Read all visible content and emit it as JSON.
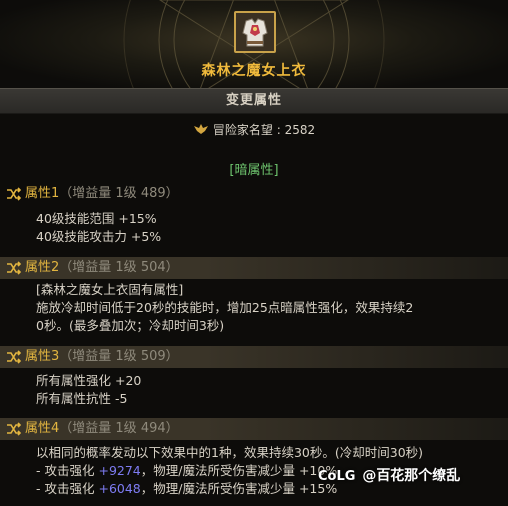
{
  "item": {
    "name": "森林之魔女上衣",
    "icon": "witch-coat-icon"
  },
  "section_title": "变更属性",
  "fame": {
    "label": "冒险家名望",
    "value": "2582"
  },
  "element_tag": "[暗属性]",
  "attributes": [
    {
      "label": "属性1",
      "gain": "（增益量 1级 489）",
      "lines": [
        "40级技能范围 +15%",
        "40级技能攻击力 +5%"
      ]
    },
    {
      "label": "属性2",
      "gain": "（增益量 1级 504）",
      "lines": [
        "[森林之魔女上衣固有属性]",
        "施放冷却时间低于20秒的技能时，增加25点暗属性强化，效果持续2",
        "0秒。(最多叠加次；冷却时间3秒)"
      ]
    },
    {
      "label": "属性3",
      "gain": "（增益量 1级 509）",
      "lines": [
        "所有属性强化 +20",
        "所有属性抗性 -5"
      ]
    },
    {
      "label": "属性4",
      "gain": "（增益量 1级 494）",
      "lines": [
        "以相同的概率发动以下效果中的1种，效果持续30秒。(冷却时间30秒)"
      ],
      "effects": [
        {
          "prefix": "- 攻击强化 ",
          "value": "+9274",
          "suffix": "，物理/魔法所受伤害减少量 +10%"
        },
        {
          "prefix": "- 攻击强化 ",
          "value": "+6048",
          "suffix": "，物理/魔法所受伤害减少量 +15%"
        }
      ]
    }
  ],
  "watermark": {
    "logo": "CoLG",
    "text": "@百花那个缭乱"
  },
  "colors": {
    "title_gold": "#f0ba3c",
    "element_green": "#6ec46e",
    "value_blue": "#7e7cf3"
  }
}
